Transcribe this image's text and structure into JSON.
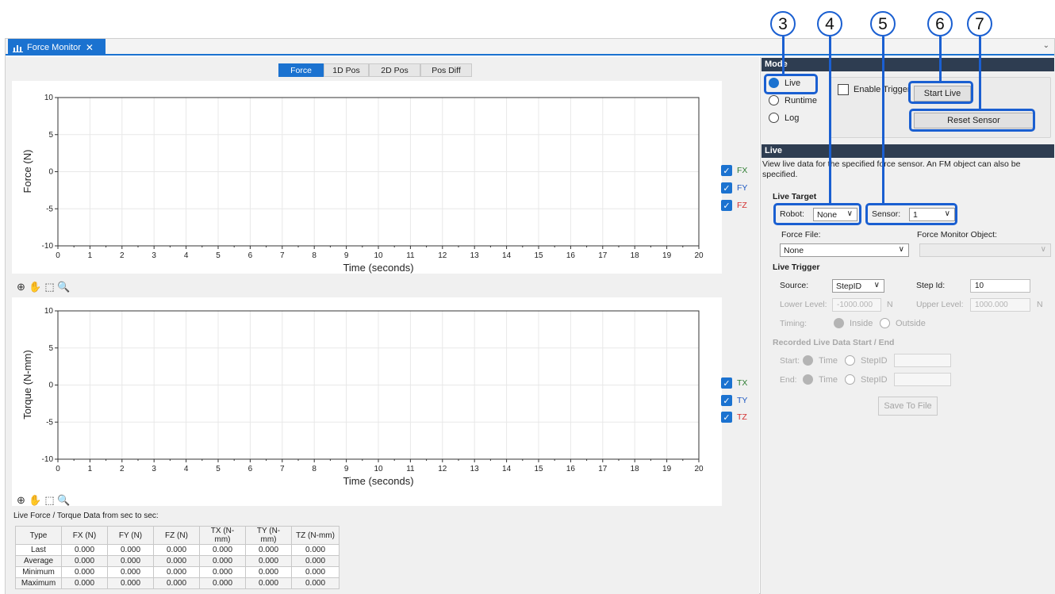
{
  "callouts": [
    "3",
    "4",
    "5",
    "6",
    "7"
  ],
  "tab": {
    "title": "Force Monitor",
    "close": "✕",
    "overflow": "⌄"
  },
  "plot_tabs": [
    "Force",
    "1D Pos",
    "2D Pos",
    "Pos Diff"
  ],
  "colors": {
    "accent": "#1b72d0",
    "callout": "#1a5fd1",
    "fx": "#2e7d32",
    "fy": "#1b57c2",
    "fz": "#d32f2f",
    "header": "#2e3d51"
  },
  "chart_data": [
    {
      "type": "line",
      "xlabel": "Time (seconds)",
      "ylabel": "Force (N)",
      "xlim": [
        0,
        20
      ],
      "ylim": [
        -10,
        10
      ],
      "x_ticks": [
        0,
        1,
        2,
        3,
        4,
        5,
        6,
        7,
        8,
        9,
        10,
        11,
        12,
        13,
        14,
        15,
        16,
        17,
        18,
        19,
        20
      ],
      "y_ticks": [
        10,
        5,
        0,
        -5,
        -10
      ],
      "grid": true,
      "series": [
        {
          "name": "FX",
          "values": []
        },
        {
          "name": "FY",
          "values": []
        },
        {
          "name": "FZ",
          "values": []
        }
      ]
    },
    {
      "type": "line",
      "xlabel": "Time (seconds)",
      "ylabel": "Torque (N-mm)",
      "xlim": [
        0,
        20
      ],
      "ylim": [
        -10,
        10
      ],
      "x_ticks": [
        0,
        1,
        2,
        3,
        4,
        5,
        6,
        7,
        8,
        9,
        10,
        11,
        12,
        13,
        14,
        15,
        16,
        17,
        18,
        19,
        20
      ],
      "y_ticks": [
        10,
        5,
        0,
        -5,
        -10
      ],
      "grid": true,
      "series": [
        {
          "name": "TX",
          "values": []
        },
        {
          "name": "TY",
          "values": []
        },
        {
          "name": "TZ",
          "values": []
        }
      ]
    }
  ],
  "legend_force": [
    "FX",
    "FY",
    "FZ"
  ],
  "legend_torque": [
    "TX",
    "TY",
    "TZ"
  ],
  "data_caption": "Live Force / Torque Data from  sec to  sec:",
  "stats": {
    "headers": [
      "Type",
      "FX (N)",
      "FY (N)",
      "FZ (N)",
      "TX (N-mm)",
      "TY (N-mm)",
      "TZ (N-mm)"
    ],
    "rows": [
      [
        "Last",
        "0.000",
        "0.000",
        "0.000",
        "0.000",
        "0.000",
        "0.000"
      ],
      [
        "Average",
        "0.000",
        "0.000",
        "0.000",
        "0.000",
        "0.000",
        "0.000"
      ],
      [
        "Minimum",
        "0.000",
        "0.000",
        "0.000",
        "0.000",
        "0.000",
        "0.000"
      ],
      [
        "Maximum",
        "0.000",
        "0.000",
        "0.000",
        "0.000",
        "0.000",
        "0.000"
      ]
    ]
  },
  "mode": {
    "header": "Mode",
    "radios": [
      "Live",
      "Runtime",
      "Log"
    ],
    "selected": "Live",
    "enable_trigger": "Enable Trigger",
    "start_live": "Start Live",
    "reset_sensor": "Reset Sensor"
  },
  "live": {
    "header": "Live",
    "description": "View live data for the specified force sensor.  An FM object can also be specified.",
    "target_title": "Live Target",
    "robot_label": "Robot:",
    "robot_value": "None",
    "sensor_label": "Sensor:",
    "sensor_value": "1",
    "force_file_label": "Force File:",
    "force_file_value": "None",
    "fm_object_label": "Force Monitor Object:",
    "fm_object_value": "",
    "trigger_title": "Live Trigger",
    "source_label": "Source:",
    "source_value": "StepID",
    "step_id_label": "Step Id:",
    "step_id_value": "10",
    "lower_label": "Lower Level:",
    "lower_value": "-1000.000",
    "lower_unit": "N",
    "upper_label": "Upper Level:",
    "upper_value": "1000.000",
    "upper_unit": "N",
    "timing_label": "Timing:",
    "inside": "Inside",
    "outside": "Outside",
    "recorded_title": "Recorded Live Data Start / End",
    "start_label": "Start:",
    "end_label": "End:",
    "time": "Time",
    "stepid": "StepID",
    "save_button": "Save To File"
  }
}
